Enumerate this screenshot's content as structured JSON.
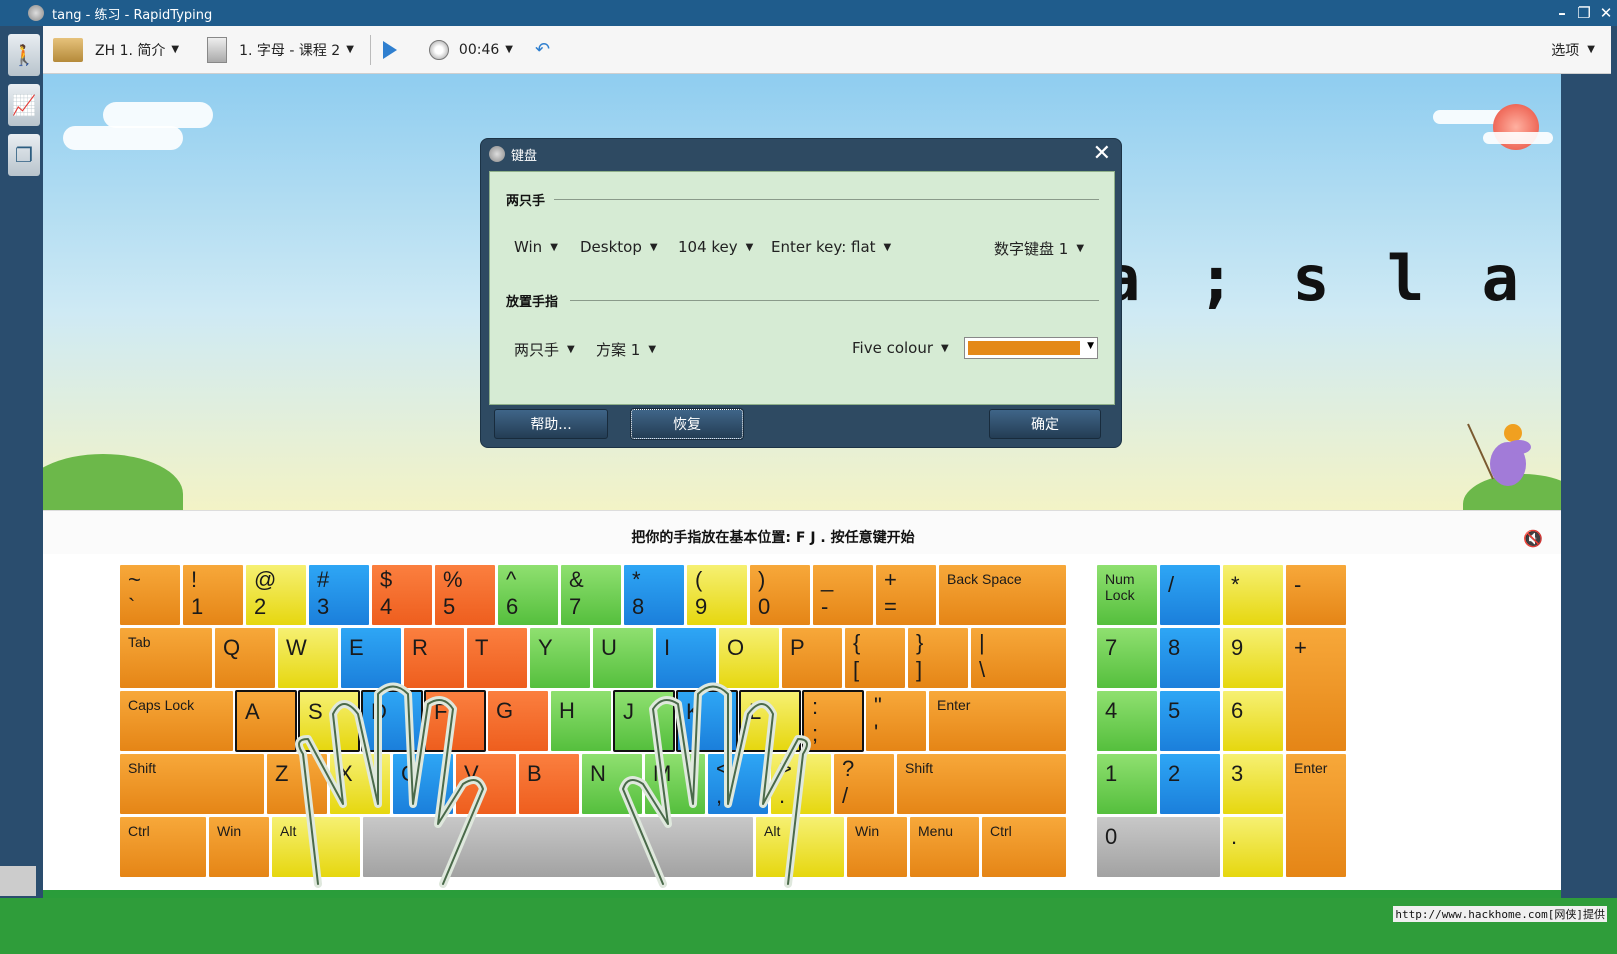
{
  "window": {
    "title": "tang - 练习 - RapidTyping"
  },
  "toolbar": {
    "course": "ZH 1. 简介",
    "lesson": "1. 字母 - 课程 2",
    "time": "00:46",
    "options": "选项"
  },
  "lesson_text": "a ; s l a",
  "instruction": "把你的手指放在基本位置: F J . 按任意键开始",
  "dialog": {
    "title": "键盘",
    "section1": "两只手",
    "os": "Win",
    "device": "Desktop",
    "layout": "104 key",
    "enter": "Enter key: flat",
    "numpad": "数字键盘 1",
    "section2": "放置手指",
    "hands": "两只手",
    "scheme": "方案 1",
    "colour_mode": "Five colour",
    "colour_value": "#e48918",
    "btn_help": "帮助...",
    "btn_restore": "恢复",
    "btn_ok": "确定"
  },
  "footer_text": "http://www.hackhome.com[网侠]提供",
  "keyboard": {
    "row1": [
      {
        "t": "~",
        "b": "`",
        "c": "orange"
      },
      {
        "t": "!",
        "b": "1",
        "c": "orange"
      },
      {
        "t": "@",
        "b": "2",
        "c": "yellow"
      },
      {
        "t": "#",
        "b": "3",
        "c": "blue"
      },
      {
        "t": "$",
        "b": "4",
        "c": "orange2"
      },
      {
        "t": "%",
        "b": "5",
        "c": "orange2"
      },
      {
        "t": "^",
        "b": "6",
        "c": "green"
      },
      {
        "t": "&",
        "b": "7",
        "c": "green"
      },
      {
        "t": "*",
        "b": "8",
        "c": "blue"
      },
      {
        "t": "(",
        "b": "9",
        "c": "yellow"
      },
      {
        "t": ")",
        "b": "0",
        "c": "orange"
      },
      {
        "t": "_",
        "b": "-",
        "c": "orange"
      },
      {
        "t": "+",
        "b": "=",
        "c": "orange"
      },
      {
        "s": "Back Space",
        "c": "orange"
      }
    ],
    "row2": [
      {
        "s": "Tab",
        "c": "orange"
      },
      {
        "k": "Q",
        "c": "orange"
      },
      {
        "k": "W",
        "c": "yellow"
      },
      {
        "k": "E",
        "c": "blue"
      },
      {
        "k": "R",
        "c": "orange2"
      },
      {
        "k": "T",
        "c": "orange2"
      },
      {
        "k": "Y",
        "c": "green"
      },
      {
        "k": "U",
        "c": "green"
      },
      {
        "k": "I",
        "c": "blue"
      },
      {
        "k": "O",
        "c": "yellow"
      },
      {
        "k": "P",
        "c": "orange"
      },
      {
        "t": "{",
        "b": "[",
        "c": "orange"
      },
      {
        "t": "}",
        "b": "]",
        "c": "orange"
      },
      {
        "t": "|",
        "b": "\\",
        "c": "orange"
      }
    ],
    "row3": [
      {
        "s": "Caps Lock",
        "c": "orange"
      },
      {
        "k": "A",
        "c": "orange"
      },
      {
        "k": "S",
        "c": "yellow"
      },
      {
        "k": "D",
        "c": "blue"
      },
      {
        "k": "F",
        "c": "orange2"
      },
      {
        "k": "G",
        "c": "orange2"
      },
      {
        "k": "H",
        "c": "green"
      },
      {
        "k": "J",
        "c": "green"
      },
      {
        "k": "K",
        "c": "blue"
      },
      {
        "k": "L",
        "c": "yellow"
      },
      {
        "t": ":",
        "b": ";",
        "c": "orange"
      },
      {
        "t": "\"",
        "b": "'",
        "c": "orange"
      },
      {
        "s": "Enter",
        "c": "orange"
      }
    ],
    "row4": [
      {
        "s": "Shift",
        "c": "orange"
      },
      {
        "k": "Z",
        "c": "orange"
      },
      {
        "k": "X",
        "c": "yellow"
      },
      {
        "k": "C",
        "c": "blue"
      },
      {
        "k": "V",
        "c": "orange2"
      },
      {
        "k": "B",
        "c": "orange2"
      },
      {
        "k": "N",
        "c": "green"
      },
      {
        "k": "M",
        "c": "green"
      },
      {
        "t": "<",
        "b": ",",
        "c": "blue"
      },
      {
        "t": ">",
        "b": ".",
        "c": "yellow"
      },
      {
        "t": "?",
        "b": "/",
        "c": "orange"
      },
      {
        "s": "Shift",
        "c": "orange"
      }
    ],
    "row5": [
      {
        "s": "Ctrl",
        "c": "orange"
      },
      {
        "s": "Win",
        "c": "orange"
      },
      {
        "s": "Alt",
        "c": "yellow"
      },
      {
        "s": "",
        "c": "gray"
      },
      {
        "s": "Alt",
        "c": "yellow"
      },
      {
        "s": "Win",
        "c": "orange"
      },
      {
        "s": "Menu",
        "c": "orange"
      },
      {
        "s": "Ctrl",
        "c": "orange"
      }
    ],
    "numpad": [
      {
        "s": "Num Lock",
        "c": "green"
      },
      {
        "k": "/",
        "c": "blue"
      },
      {
        "k": "*",
        "c": "yellow"
      },
      {
        "k": "-",
        "c": "orange"
      },
      {
        "k": "7",
        "c": "green"
      },
      {
        "k": "8",
        "c": "blue"
      },
      {
        "k": "9",
        "c": "yellow"
      },
      {
        "k": "+",
        "c": "orange"
      },
      {
        "k": "4",
        "c": "green"
      },
      {
        "k": "5",
        "c": "blue"
      },
      {
        "k": "6",
        "c": "yellow"
      },
      {
        "k": "1",
        "c": "green"
      },
      {
        "k": "2",
        "c": "blue"
      },
      {
        "k": "3",
        "c": "yellow"
      },
      {
        "s": "Enter",
        "c": "orange"
      },
      {
        "k": "0",
        "c": "gray"
      },
      {
        "k": ".",
        "c": "yellow"
      }
    ]
  }
}
